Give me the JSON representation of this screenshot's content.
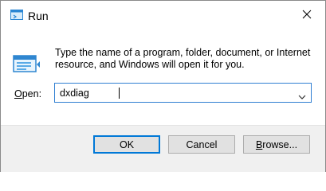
{
  "window": {
    "title": "Run"
  },
  "dialog": {
    "description": "Type the name of a program, folder, document, or Internet resource, and Windows will open it for you.",
    "open_label_underlined": "O",
    "open_label_rest": "pen:",
    "input_value": "dxdiag"
  },
  "buttons": {
    "ok": "OK",
    "cancel": "Cancel",
    "browse_underlined": "B",
    "browse_rest": "rowse..."
  },
  "icons": [
    "run-app-icon",
    "close-icon",
    "run-icon",
    "chevron-down-icon"
  ],
  "colors": {
    "focus_border": "#2f7fd2",
    "default_button_border": "#0078d7",
    "footer_bg": "#f0f0f0"
  }
}
